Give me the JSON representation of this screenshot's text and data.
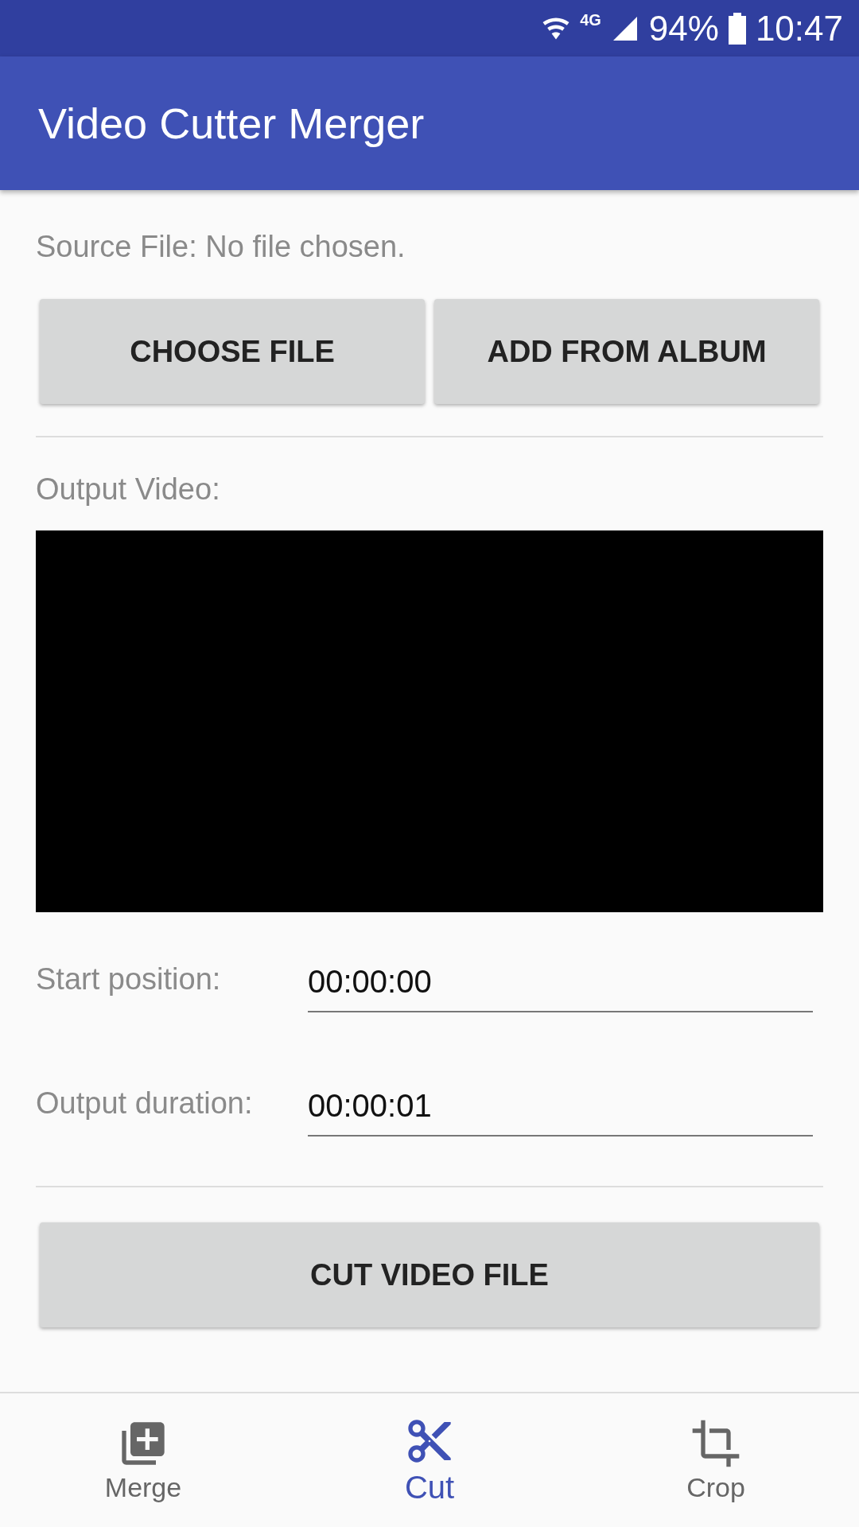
{
  "status_bar": {
    "network": "4G",
    "battery": "94%",
    "time": "10:47"
  },
  "app_bar": {
    "title": "Video Cutter Merger"
  },
  "source_file": "Source File: No file chosen.",
  "source_buttons": [
    "CHOOSE FILE",
    "ADD FROM ALBUM"
  ],
  "output_label": "Output Video:",
  "fields": [
    {
      "label": "Start position:",
      "value": "00:00:00"
    },
    {
      "label": "Output duration:",
      "value": "00:00:01"
    }
  ],
  "action_button": "CUT VIDEO FILE",
  "bottom_nav": [
    {
      "kind": "merge",
      "label": "Merge",
      "selected": false
    },
    {
      "kind": "cut",
      "label": "Cut",
      "selected": true
    },
    {
      "kind": "crop",
      "label": "Crop",
      "selected": false
    }
  ]
}
